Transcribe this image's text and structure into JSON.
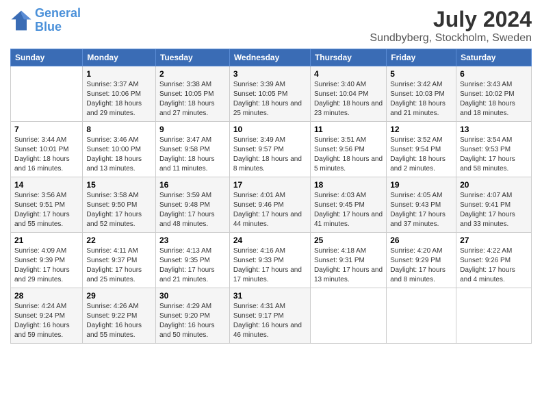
{
  "logo": {
    "line1": "General",
    "line2": "Blue"
  },
  "title": "July 2024",
  "subtitle": "Sundbyberg, Stockholm, Sweden",
  "weekdays": [
    "Sunday",
    "Monday",
    "Tuesday",
    "Wednesday",
    "Thursday",
    "Friday",
    "Saturday"
  ],
  "weeks": [
    [
      {
        "day": "",
        "sunrise": "",
        "sunset": "",
        "daylight": ""
      },
      {
        "day": "1",
        "sunrise": "Sunrise: 3:37 AM",
        "sunset": "Sunset: 10:06 PM",
        "daylight": "Daylight: 18 hours and 29 minutes."
      },
      {
        "day": "2",
        "sunrise": "Sunrise: 3:38 AM",
        "sunset": "Sunset: 10:05 PM",
        "daylight": "Daylight: 18 hours and 27 minutes."
      },
      {
        "day": "3",
        "sunrise": "Sunrise: 3:39 AM",
        "sunset": "Sunset: 10:05 PM",
        "daylight": "Daylight: 18 hours and 25 minutes."
      },
      {
        "day": "4",
        "sunrise": "Sunrise: 3:40 AM",
        "sunset": "Sunset: 10:04 PM",
        "daylight": "Daylight: 18 hours and 23 minutes."
      },
      {
        "day": "5",
        "sunrise": "Sunrise: 3:42 AM",
        "sunset": "Sunset: 10:03 PM",
        "daylight": "Daylight: 18 hours and 21 minutes."
      },
      {
        "day": "6",
        "sunrise": "Sunrise: 3:43 AM",
        "sunset": "Sunset: 10:02 PM",
        "daylight": "Daylight: 18 hours and 18 minutes."
      }
    ],
    [
      {
        "day": "7",
        "sunrise": "Sunrise: 3:44 AM",
        "sunset": "Sunset: 10:01 PM",
        "daylight": "Daylight: 18 hours and 16 minutes."
      },
      {
        "day": "8",
        "sunrise": "Sunrise: 3:46 AM",
        "sunset": "Sunset: 10:00 PM",
        "daylight": "Daylight: 18 hours and 13 minutes."
      },
      {
        "day": "9",
        "sunrise": "Sunrise: 3:47 AM",
        "sunset": "Sunset: 9:58 PM",
        "daylight": "Daylight: 18 hours and 11 minutes."
      },
      {
        "day": "10",
        "sunrise": "Sunrise: 3:49 AM",
        "sunset": "Sunset: 9:57 PM",
        "daylight": "Daylight: 18 hours and 8 minutes."
      },
      {
        "day": "11",
        "sunrise": "Sunrise: 3:51 AM",
        "sunset": "Sunset: 9:56 PM",
        "daylight": "Daylight: 18 hours and 5 minutes."
      },
      {
        "day": "12",
        "sunrise": "Sunrise: 3:52 AM",
        "sunset": "Sunset: 9:54 PM",
        "daylight": "Daylight: 18 hours and 2 minutes."
      },
      {
        "day": "13",
        "sunrise": "Sunrise: 3:54 AM",
        "sunset": "Sunset: 9:53 PM",
        "daylight": "Daylight: 17 hours and 58 minutes."
      }
    ],
    [
      {
        "day": "14",
        "sunrise": "Sunrise: 3:56 AM",
        "sunset": "Sunset: 9:51 PM",
        "daylight": "Daylight: 17 hours and 55 minutes."
      },
      {
        "day": "15",
        "sunrise": "Sunrise: 3:58 AM",
        "sunset": "Sunset: 9:50 PM",
        "daylight": "Daylight: 17 hours and 52 minutes."
      },
      {
        "day": "16",
        "sunrise": "Sunrise: 3:59 AM",
        "sunset": "Sunset: 9:48 PM",
        "daylight": "Daylight: 17 hours and 48 minutes."
      },
      {
        "day": "17",
        "sunrise": "Sunrise: 4:01 AM",
        "sunset": "Sunset: 9:46 PM",
        "daylight": "Daylight: 17 hours and 44 minutes."
      },
      {
        "day": "18",
        "sunrise": "Sunrise: 4:03 AM",
        "sunset": "Sunset: 9:45 PM",
        "daylight": "Daylight: 17 hours and 41 minutes."
      },
      {
        "day": "19",
        "sunrise": "Sunrise: 4:05 AM",
        "sunset": "Sunset: 9:43 PM",
        "daylight": "Daylight: 17 hours and 37 minutes."
      },
      {
        "day": "20",
        "sunrise": "Sunrise: 4:07 AM",
        "sunset": "Sunset: 9:41 PM",
        "daylight": "Daylight: 17 hours and 33 minutes."
      }
    ],
    [
      {
        "day": "21",
        "sunrise": "Sunrise: 4:09 AM",
        "sunset": "Sunset: 9:39 PM",
        "daylight": "Daylight: 17 hours and 29 minutes."
      },
      {
        "day": "22",
        "sunrise": "Sunrise: 4:11 AM",
        "sunset": "Sunset: 9:37 PM",
        "daylight": "Daylight: 17 hours and 25 minutes."
      },
      {
        "day": "23",
        "sunrise": "Sunrise: 4:13 AM",
        "sunset": "Sunset: 9:35 PM",
        "daylight": "Daylight: 17 hours and 21 minutes."
      },
      {
        "day": "24",
        "sunrise": "Sunrise: 4:16 AM",
        "sunset": "Sunset: 9:33 PM",
        "daylight": "Daylight: 17 hours and 17 minutes."
      },
      {
        "day": "25",
        "sunrise": "Sunrise: 4:18 AM",
        "sunset": "Sunset: 9:31 PM",
        "daylight": "Daylight: 17 hours and 13 minutes."
      },
      {
        "day": "26",
        "sunrise": "Sunrise: 4:20 AM",
        "sunset": "Sunset: 9:29 PM",
        "daylight": "Daylight: 17 hours and 8 minutes."
      },
      {
        "day": "27",
        "sunrise": "Sunrise: 4:22 AM",
        "sunset": "Sunset: 9:26 PM",
        "daylight": "Daylight: 17 hours and 4 minutes."
      }
    ],
    [
      {
        "day": "28",
        "sunrise": "Sunrise: 4:24 AM",
        "sunset": "Sunset: 9:24 PM",
        "daylight": "Daylight: 16 hours and 59 minutes."
      },
      {
        "day": "29",
        "sunrise": "Sunrise: 4:26 AM",
        "sunset": "Sunset: 9:22 PM",
        "daylight": "Daylight: 16 hours and 55 minutes."
      },
      {
        "day": "30",
        "sunrise": "Sunrise: 4:29 AM",
        "sunset": "Sunset: 9:20 PM",
        "daylight": "Daylight: 16 hours and 50 minutes."
      },
      {
        "day": "31",
        "sunrise": "Sunrise: 4:31 AM",
        "sunset": "Sunset: 9:17 PM",
        "daylight": "Daylight: 16 hours and 46 minutes."
      },
      {
        "day": "",
        "sunrise": "",
        "sunset": "",
        "daylight": ""
      },
      {
        "day": "",
        "sunrise": "",
        "sunset": "",
        "daylight": ""
      },
      {
        "day": "",
        "sunrise": "",
        "sunset": "",
        "daylight": ""
      }
    ]
  ]
}
